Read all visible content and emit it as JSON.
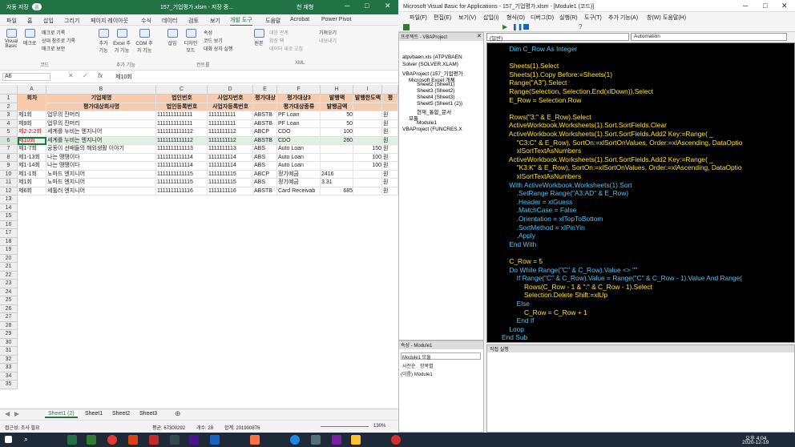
{
  "excel": {
    "autosave": "자동 저장",
    "autosave_state": "끔",
    "title": "157_기업평가.xlsm - 저장 중...",
    "user": "천 재형",
    "tabs": [
      "파일",
      "홈",
      "삽입",
      "그리기",
      "페이지 레이아웃",
      "수식",
      "데이터",
      "검토",
      "보기",
      "개발 도구",
      "도움말",
      "Acrobat",
      "Power Pivot"
    ],
    "ribbon": {
      "vb": "Visual Basic",
      "macro": "매크로",
      "rec": "매크로 기록",
      "rel": "상대 참조로 기록",
      "sec": "매크로 보안",
      "code_grp": "코드",
      "addin": "추가 기능",
      "excel_addin": "Excel 추가 기능",
      "com": "COM 추가 기능",
      "addin_grp": "추가 기능",
      "insert": "삽입",
      "design": "디자인 모드",
      "prop": "속성",
      "view": "코드 보기",
      "dialog": "대화 상자 실행",
      "ctrl_grp": "컨트롤",
      "source": "원본",
      "map": "대응 관계",
      "ext": "확장 팩",
      "refresh": "데이터 새로 고침",
      "import": "가져오기",
      "export": "내보내기",
      "xml_grp": "XML"
    },
    "namebox": "A6",
    "formula": "제10회",
    "cols": [
      "A",
      "B",
      "C",
      "D",
      "E",
      "F",
      "H",
      "I"
    ],
    "rows": [
      "1",
      "2",
      "3",
      "4",
      "5",
      "6",
      "7",
      "8",
      "9",
      "10",
      "11",
      "12",
      "13",
      "14",
      "15",
      "16",
      "17",
      "18",
      "19",
      "20",
      "21",
      "22",
      "23",
      "24",
      "25",
      "26",
      "27",
      "28",
      "29",
      "30",
      "31",
      "32",
      "33",
      "34",
      "35"
    ],
    "header1": [
      "회차",
      "기업체명",
      "법인번호",
      "사업자번호",
      "평가대상",
      "평가대상3",
      "발행액",
      "발행한도액",
      "평"
    ],
    "header2": [
      "",
      "평가대상회사명",
      "법인등록번호",
      "사업자등록번호",
      "",
      "평가대상종류",
      "발행금액",
      "",
      ""
    ],
    "data": [
      [
        "제1회",
        "업무의 잔머리",
        "1111111111111",
        "1111111111",
        "ABSTB",
        "PF Loan",
        "50",
        "",
        "원"
      ],
      [
        "제9회",
        "업무의 잔머리",
        "1111111111111",
        "1111111111",
        "ABSTB",
        "PF Loan",
        "50",
        "",
        "원"
      ],
      [
        "제2-2:2회",
        "세계를 누비는 엔지니어",
        "1111111111112",
        "1111111112",
        "ABCP",
        "CDO",
        "100",
        "",
        "원"
      ],
      [
        "제10회",
        "세계를 누비는 엔지니어",
        "1111111111112",
        "1111111112",
        "ABSTB",
        "CDO",
        "260",
        "",
        "원"
      ],
      [
        "제1-7회",
        "공동이 선배들의 해외생활 이야기",
        "1111111111113",
        "1111111113",
        "ABS",
        "Auto Loan",
        "",
        "150",
        "원"
      ],
      [
        "제1-13회",
        "나는 땡땡이다",
        "1111111111114",
        "1111111114",
        "ABS",
        "Auto Loan",
        "",
        "100",
        "원"
      ],
      [
        "제1-14회",
        "나는 땡땡이다",
        "1111111111114",
        "1111111114",
        "ABS",
        "Auto Loan",
        "",
        "100",
        "원"
      ],
      [
        "제1-1회",
        "노마드 엔지니어",
        "1111111111115",
        "1111111115",
        "ABCP",
        "정기예금",
        "2416",
        "",
        "원"
      ],
      [
        "제1회",
        "노마드 엔지니어",
        "1111111111115",
        "1111111115",
        "ABS",
        "정기예금",
        "3.31",
        "",
        "원"
      ],
      [
        "제6회",
        "세툴러 엔지니어",
        "1111111111116",
        "1111111116",
        "ABSTB",
        "Card Receivab",
        "685",
        "",
        "원"
      ]
    ],
    "sheets": [
      "Sheet1 (2)",
      "Sheet1",
      "Sheet2",
      "Sheet3"
    ],
    "status": {
      "ready": "접근성: 조사 필요",
      "avg": "평균: 67300292",
      "count": "개수: 28",
      "sum": "합계: 201900876",
      "zoom": "130%"
    }
  },
  "vba": {
    "title": "Microsoft Visual Basic for Applications - 157_기업평가.xlsm - [Module1 (코드)]",
    "menu": [
      "파일(F)",
      "편집(E)",
      "보기(V)",
      "삽입(I)",
      "형식(O)",
      "디버그(D)",
      "실행(R)",
      "도구(T)",
      "추가 기능(A)",
      "창(W)",
      "도움말(H)"
    ],
    "proj_title": "프로젝트 - VBAProject",
    "tree": [
      "atpvbaen.xls (ATPVBAEN",
      "Solver (SOLVER.XLAM)",
      "VBAProject (157_기업평가",
      "Microsoft Excel 개체",
      "Sheet2 (Sheet1)",
      "Sheet3 (Sheet2)",
      "Sheet4 (Sheet3)",
      "Sheet5 (Sheet1 (2))",
      "현재_통합_문서",
      "모듈",
      "Module1",
      "VBAProject (FUNCRES.X"
    ],
    "props_title": "속성 - Module1",
    "props_obj": "Module1 모듈",
    "props_tabs": [
      "사전순",
      "항목별"
    ],
    "props_row": "(이름) Module1",
    "combo_left": "(일반)",
    "combo_right": "Automation",
    "immediate": "직접 실행",
    "code": [
      [
        "    ",
        "kw",
        "Dim C_Row As Integer"
      ],
      [
        "",
        "",
        " "
      ],
      [
        "    ",
        "tx",
        "Sheets(1).Select"
      ],
      [
        "    ",
        "tx",
        "Sheets(1).Copy Before:=Sheets(1)"
      ],
      [
        "    ",
        "tx",
        "Range(\"A3\").Select"
      ],
      [
        "    ",
        "tx",
        "Range(Selection, Selection.End(xlDown)).Select"
      ],
      [
        "    ",
        "tx",
        "E_Row = Selection.Row"
      ],
      [
        "",
        "",
        " "
      ],
      [
        "    ",
        "tx",
        "Rows(\"3:\" & E_Row).Select"
      ],
      [
        "    ",
        "tx",
        "ActiveWorkbook.Worksheets(1).Sort.SortFields.Clear"
      ],
      [
        "    ",
        "tx",
        "ActiveWorkbook.Worksheets(1).Sort.SortFields.Add2 Key:=Range( _"
      ],
      [
        "        ",
        "tx",
        "\"C3:C\" & E_Row), SortOn:=xlSortOnValues, Order:=xlAscending, DataOptio"
      ],
      [
        "        ",
        "tx",
        "xlSortTextAsNumbers"
      ],
      [
        "    ",
        "tx",
        "ActiveWorkbook.Worksheets(1).Sort.SortFields.Add2 Key:=Range( _"
      ],
      [
        "        ",
        "tx",
        "\"K3:K\" & E_Row), SortOn:=xlSortOnValues, Order:=xlAscending, DataOptio"
      ],
      [
        "        ",
        "tx",
        "xlSortTextAsNumbers"
      ],
      [
        "    ",
        "kw",
        "With ActiveWorkbook.Worksheets(1).Sort"
      ],
      [
        "        ",
        "kw",
        ".SetRange Range(\"A3:AD\" & E_Row)"
      ],
      [
        "        ",
        "kw",
        ".Header = xlGuess"
      ],
      [
        "        ",
        "kw",
        ".MatchCase = False"
      ],
      [
        "        ",
        "kw",
        ".Orientation = xlTopToBottom"
      ],
      [
        "        ",
        "kw",
        ".SortMethod = xlPinYin"
      ],
      [
        "        ",
        "kw",
        ".Apply"
      ],
      [
        "    ",
        "kw",
        "End With"
      ],
      [
        "",
        "",
        " "
      ],
      [
        "    ",
        "tx",
        "C_Row = 5"
      ],
      [
        "    ",
        "kw",
        "Do While Range(\"C\" & C_Row).Value <> \"\""
      ],
      [
        "        ",
        "kw",
        "If Range(\"C\" & C_Row).Value = Range(\"C\" & C_Row - 1).Value And Range("
      ],
      [
        "            ",
        "tx",
        "Rows(C_Row - 1 & \":\" & C_Row - 1).Select"
      ],
      [
        "            ",
        "tx",
        "Selection.Delete Shift:=xlUp"
      ],
      [
        "        ",
        "kw",
        "Else"
      ],
      [
        "            ",
        "tx",
        "C_Row = C_Row + 1"
      ],
      [
        "        ",
        "kw",
        "End If"
      ],
      [
        "    ",
        "kw",
        "Loop"
      ],
      [
        "",
        "kw",
        "End Sub"
      ]
    ]
  },
  "taskbar": {
    "time": "오후 4:04",
    "date": "2020-12-19"
  },
  "colors": {
    "excel_green": "#217346",
    "header_fill": "#f8cbad",
    "code_bg": "#000000",
    "keyword": "#4fc3f7",
    "text": "#ffe033"
  }
}
